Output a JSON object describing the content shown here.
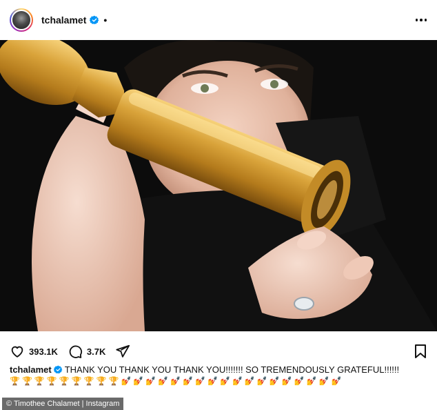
{
  "post": {
    "username": "tchalamet",
    "dot": "•",
    "likes": "393.1K",
    "comments": "3.7K",
    "caption_user": "tchalamet",
    "caption_text": "THANK YOU THANK YOU THANK YOU!!!!!!! SO TREMENDOUSLY GRATEFUL!!!!!!",
    "caption_emojis": "🏆🏆🏆🏆🏆🏆🏆🏆🏆💅💅💅💅💅💅💅💅💅💅💅💅💅💅💅💅💅💅",
    "credit": "© Timothee Chalamet | Instagram"
  },
  "icons": {
    "avatar": "profile-avatar",
    "verified": "verified-badge-icon",
    "more": "more-options-icon",
    "like": "heart-icon",
    "comment": "comment-bubble-icon",
    "share": "paper-plane-icon",
    "save": "bookmark-icon"
  },
  "colors": {
    "verified": "#0095f6",
    "text": "#111111",
    "trophy_gold": "#d9a93a"
  }
}
